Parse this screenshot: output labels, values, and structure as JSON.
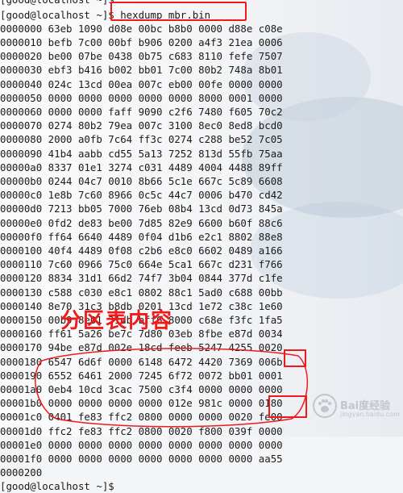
{
  "terminal": {
    "top_partial_line": "[good@localhost ~]$",
    "prompt_line": "[good@localhost ~]$",
    "command_prompt": "[good@localhost ~]",
    "command": "$ hexdump mbr.bin",
    "dump_lines": [
      "0000000 63eb 1090 d08e 00bc b8b0 0000 d88e c08e",
      "0000010 befb 7c00 00bf b906 0200 a4f3 21ea 0006",
      "0000020 be00 07be 0438 0b75 c683 8110 fefe 7507",
      "0000030 ebf3 b416 b002 bb01 7c00 80b2 748a 8b01",
      "0000040 024c 13cd 00ea 007c eb00 00fe 0000 0000",
      "0000050 0000 0000 0000 0000 0000 8000 0001 0000",
      "0000060 0000 0000 faff 9090 c2f6 7480 f605 70c2",
      "0000070 0274 80b2 79ea 007c 3100 8ec0 8ed8 bcd0",
      "0000080 2000 a0fb 7c64 ff3c 0274 c288 be52 7c05",
      "0000090 41b4 aabb cd55 5a13 7252 813d 55fb 75aa",
      "00000a0 8337 01e1 3274 c031 4489 4004 4488 89ff",
      "00000b0 0244 04c7 0010 8b66 5c1e 667c 5c89 6608",
      "00000c0 1e8b 7c60 8966 0c5c 44c7 0006 b470 cd42",
      "00000d0 7213 bb05 7000 76eb 08b4 13cd 0d73 845a",
      "00000e0 0fd2 de83 be00 7d85 82e9 6600 b60f 88c6",
      "00000f0 ff64 6640 4489 0f04 d1b6 e2c1 8802 88e8",
      "0000100 40f4 4489 0f08 c2b6 e8c0 6602 0489 a166",
      "0000110 7c60 0966 75c0 664e 5ca1 667c d231 f766",
      "0000120 8834 31d1 66d2 74f7 3b04 0844 377d c1fe",
      "0000130 c588 c030 e8c1 0802 88c1 5ad0 c688 00bb",
      "0000140 8e70 31c3 b8db 0201 13cd 1e72 c38c 1e60",
      "0000150 00b9 8e01 31db bff6 8000 c68e f3fc 1fa5",
      "0000160 ff61 5a26 be7c 7d80 03eb 8fbe e87d 0034",
      "0000170 94be e87d 002e 18cd feeb 5247 4255 0020",
      "0000180 6547 6d6f 0000 6148 6472 4420 7369 006b",
      "0000190 6552 6461 2000 7245 6f72 0072 bb01 0001",
      "00001a0 0eb4 10cd 3cac 7500 c3f4 0000 0000 0000",
      "00001b0 0000 0000 0000 0000 012e 981c 0000 0180",
      "00001c0 0401 fe83 ffc2 0800 0000 0000 0020 fe00",
      "00001d0 ffc2 fe83 ffc2 0800 0020 f800 039f 0000",
      "00001e0 0000 0000 0000 0000 0000 0000 0000 0000",
      "00001f0 0000 0000 0000 0000 0000 0000 0000 aa55",
      "0000200"
    ]
  },
  "annotation": {
    "label": "分区表内容",
    "highlight_color": "#ef1a1a"
  },
  "watermark": {
    "icon": "paw-icon",
    "title": "Bai度经验",
    "subtitle": "jingyan.baidu.com"
  }
}
